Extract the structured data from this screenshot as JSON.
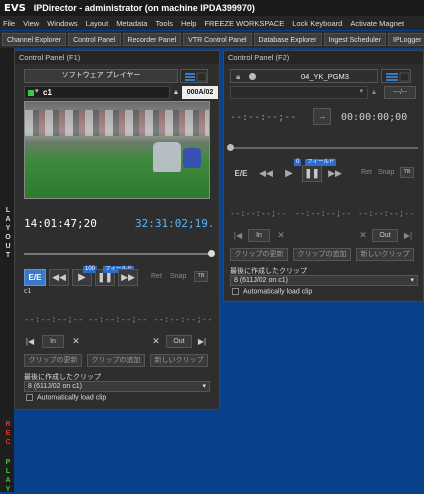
{
  "titlebar": {
    "logo": "EVS",
    "title": "IPDirector  - administrator (on machine IPDA399970)"
  },
  "menu": [
    "File",
    "View",
    "Windows",
    "Layout",
    "Metadata",
    "Tools",
    "Help",
    "FREEZE WORKSPACE",
    "Lock Keyboard",
    "Activate Magnet"
  ],
  "tabs": [
    "Channel Explorer",
    "Control Panel",
    "Recorder Panel",
    "VTR Control Panel",
    "Database Explorer",
    "Ingest Scheduler",
    "IPLogger",
    "Ke"
  ],
  "sidebar": {
    "layout": "LAYOUT",
    "rec": "REC",
    "play": "PLAY"
  },
  "p1": {
    "title": "Control Panel (F1)",
    "player": "ソフトウェア プレイヤー",
    "channel": "c1",
    "clipcode": "000A/02",
    "tc_left": "14:01:47;20",
    "tc_right": "32:31:02;19.",
    "ee": "E/E",
    "speed": "100",
    "field": "フィールド",
    "ret": "Ret",
    "snap": "Snap",
    "channel_label": "c1",
    "in_tc": "--:--:--;--",
    "dur_tc": "--:--:--;--",
    "out_tc": "--:--:--;--",
    "in": "In",
    "out": "Out",
    "update_clip": "クリップの更新",
    "add_clip": "クリップの追加",
    "new_clip": "新しいクリップ",
    "last_clip_label": "最後に作成したクリップ",
    "last_clip_value": "8 (611J/02 on c1)",
    "auto_load": "Automatically load clip"
  },
  "p2": {
    "title": "Control Panel (F2)",
    "channel": "04_YK_PGM3",
    "clipcode": "---/--",
    "tc_left": "--:--:--;--",
    "tc_right": "00:00:00;00",
    "ee": "E/E",
    "speed": "0",
    "field": "フィールド",
    "ret": "Ret",
    "snap": "Snap",
    "in_tc": "--:--:--;--",
    "dur_tc": "--:--:--;--",
    "out_tc": "--:--:--;--",
    "in": "In",
    "out": "Out",
    "update_clip": "クリップの更新",
    "add_clip": "クリップの追加",
    "new_clip": "新しいクリップ",
    "last_clip_label": "最後に作成したクリップ",
    "last_clip_value": "8 (611J/02 on c1)",
    "auto_load": "Automatically load clip"
  },
  "colors": {
    "accent": "#3a78c8",
    "timecode_blue": "#58b6ff",
    "desktop": "#0a3f8a",
    "rec_red": "#e03030",
    "play_green": "#3cc83c"
  }
}
